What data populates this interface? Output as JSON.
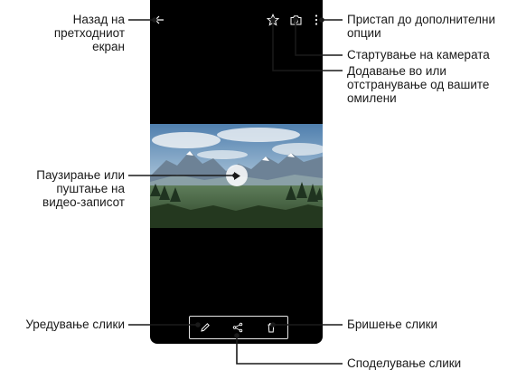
{
  "callouts": {
    "back": [
      "Назад на",
      "претходниот",
      "екран"
    ],
    "play": [
      "Паузирање или",
      "пуштање на",
      "видео-записот"
    ],
    "edit": [
      "Уредување слики"
    ],
    "more": [
      "Пристап до дополнителни",
      "опции"
    ],
    "camera": [
      "Стартување на камерата"
    ],
    "favorite": [
      "Додавање во или",
      "отстранување од вашите",
      "омилени"
    ],
    "delete": [
      "Бришење слики"
    ],
    "share": [
      "Споделување слики"
    ]
  },
  "icons": {
    "back": "back-arrow-icon",
    "favorite": "star-icon",
    "camera": "camera-icon",
    "more": "more-vertical-icon",
    "play": "play-icon",
    "edit": "pencil-icon",
    "share": "share-icon",
    "delete": "trash-icon"
  },
  "colors": {
    "screen": "#000000",
    "leader": "#1a1a1a",
    "icon": "#ffffff"
  }
}
